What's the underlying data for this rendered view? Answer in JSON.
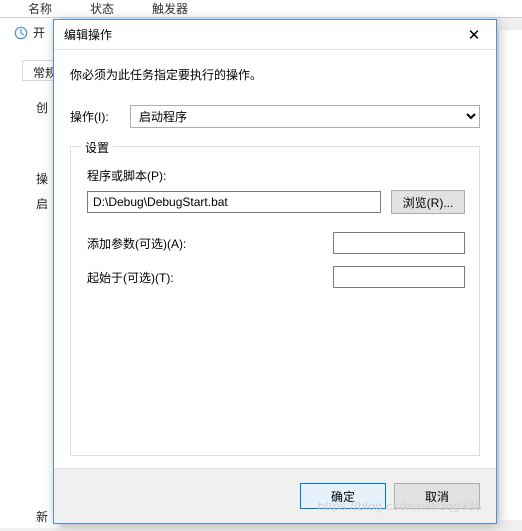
{
  "bg": {
    "col1": "名称",
    "col2": "状态",
    "col3": "触发器",
    "window_title_fragment": "开",
    "tab_general": "常规",
    "label_create": "创",
    "label_op": "操",
    "label_start": "启",
    "label_new": "新"
  },
  "dialog": {
    "title": "编辑操作",
    "close_symbol": "✕",
    "instruction": "你必须为此任务指定要执行的操作。",
    "action_label": "操作(I):",
    "action_value": "启动程序",
    "fieldset_legend": "设置",
    "program_label": "程序或脚本(P):",
    "program_value": "D:\\Debug\\DebugStart.bat",
    "browse_label": "浏览(R)...",
    "args_label": "添加参数(可选)(A):",
    "args_value": "",
    "startin_label": "起始于(可选)(T):",
    "startin_value": "",
    "ok_label": "确定",
    "cancel_label": "取消"
  },
  "watermark": "https://blog.csdn.net/zqg935"
}
